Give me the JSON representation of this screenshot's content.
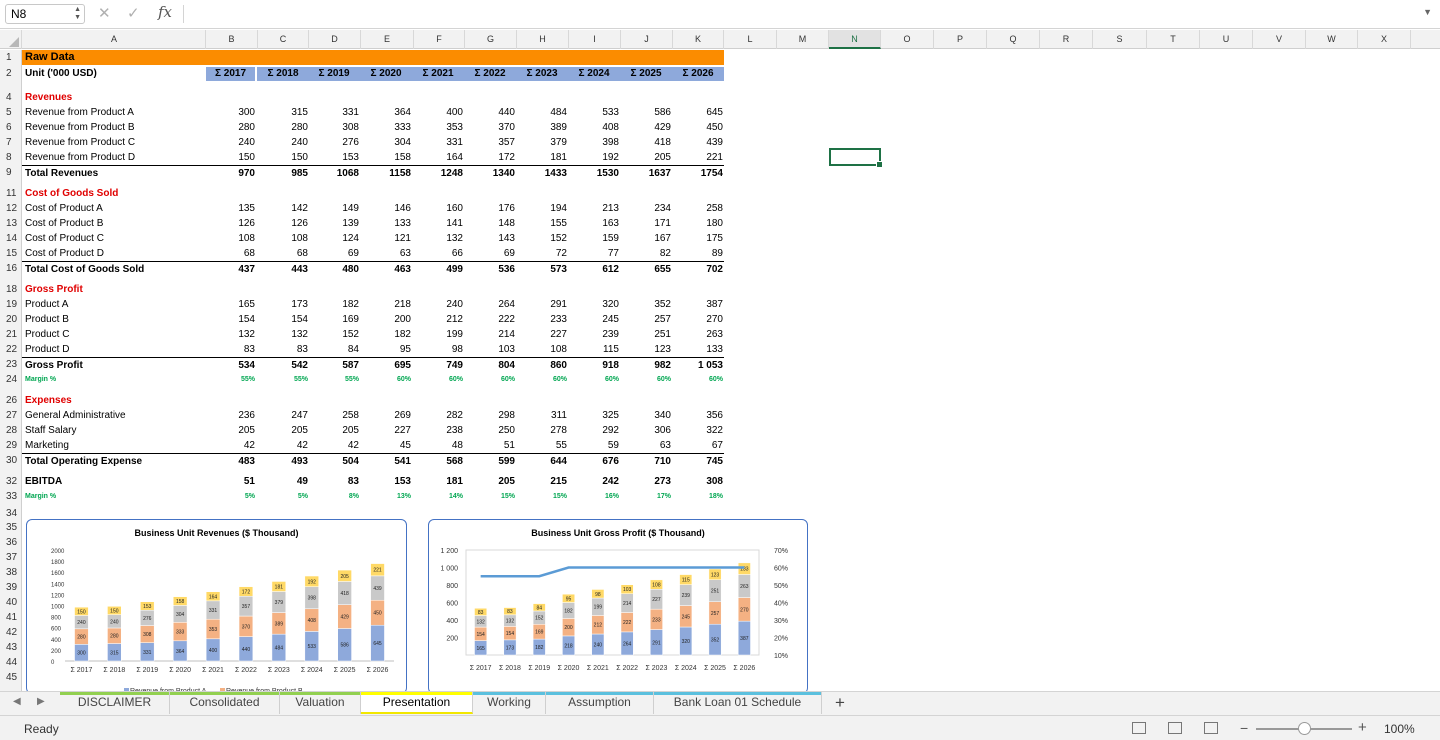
{
  "formula_bar": {
    "name_box": "N8",
    "fx": "fx",
    "formula": ""
  },
  "columns": [
    "A",
    "B",
    "C",
    "D",
    "E",
    "F",
    "G",
    "H",
    "I",
    "J",
    "K",
    "L",
    "M",
    "N",
    "O",
    "P",
    "Q",
    "R",
    "S",
    "T",
    "U",
    "V",
    "W",
    "X"
  ],
  "selected_cell": "N8",
  "sheet": {
    "title": "Raw Data",
    "unit_label": "Unit ('000 USD)",
    "years": [
      "Σ 2017",
      "Σ 2018",
      "Σ 2019",
      "Σ 2020",
      "Σ 2021",
      "Σ 2022",
      "Σ 2023",
      "Σ 2024",
      "Σ 2025",
      "Σ 2026"
    ],
    "rows": [
      {
        "n": "4",
        "label": "Revenues",
        "type": "sec"
      },
      {
        "n": "5",
        "label": "Revenue from Product A",
        "values": [
          "300",
          "315",
          "331",
          "364",
          "400",
          "440",
          "484",
          "533",
          "586",
          "645"
        ]
      },
      {
        "n": "6",
        "label": "Revenue from Product B",
        "values": [
          "280",
          "280",
          "308",
          "333",
          "353",
          "370",
          "389",
          "408",
          "429",
          "450"
        ]
      },
      {
        "n": "7",
        "label": "Revenue from Product C",
        "values": [
          "240",
          "240",
          "276",
          "304",
          "331",
          "357",
          "379",
          "398",
          "418",
          "439"
        ]
      },
      {
        "n": "8",
        "label": "Revenue from Product D",
        "values": [
          "150",
          "150",
          "153",
          "158",
          "164",
          "172",
          "181",
          "192",
          "205",
          "221"
        ]
      },
      {
        "n": "9",
        "label": "Total Revenues",
        "type": "tot",
        "values": [
          "970",
          "985",
          "1068",
          "1158",
          "1248",
          "1340",
          "1433",
          "1530",
          "1637",
          "1754"
        ]
      },
      {
        "n": "11",
        "label": "Cost of Goods Sold",
        "type": "sec"
      },
      {
        "n": "12",
        "label": "Cost of Product A",
        "values": [
          "135",
          "142",
          "149",
          "146",
          "160",
          "176",
          "194",
          "213",
          "234",
          "258"
        ]
      },
      {
        "n": "13",
        "label": "Cost of Product B",
        "values": [
          "126",
          "126",
          "139",
          "133",
          "141",
          "148",
          "155",
          "163",
          "171",
          "180"
        ]
      },
      {
        "n": "14",
        "label": "Cost of Product C",
        "values": [
          "108",
          "108",
          "124",
          "121",
          "132",
          "143",
          "152",
          "159",
          "167",
          "175"
        ]
      },
      {
        "n": "15",
        "label": "Cost of Product D",
        "values": [
          "68",
          "68",
          "69",
          "63",
          "66",
          "69",
          "72",
          "77",
          "82",
          "89"
        ]
      },
      {
        "n": "16",
        "label": "Total Cost of Goods Sold",
        "type": "tot",
        "values": [
          "437",
          "443",
          "480",
          "463",
          "499",
          "536",
          "573",
          "612",
          "655",
          "702"
        ]
      },
      {
        "n": "18",
        "label": "Gross Profit",
        "type": "sec"
      },
      {
        "n": "19",
        "label": "Product A",
        "values": [
          "165",
          "173",
          "182",
          "218",
          "240",
          "264",
          "291",
          "320",
          "352",
          "387"
        ]
      },
      {
        "n": "20",
        "label": "Product B",
        "values": [
          "154",
          "154",
          "169",
          "200",
          "212",
          "222",
          "233",
          "245",
          "257",
          "270"
        ]
      },
      {
        "n": "21",
        "label": "Product C",
        "values": [
          "132",
          "132",
          "152",
          "182",
          "199",
          "214",
          "227",
          "239",
          "251",
          "263"
        ]
      },
      {
        "n": "22",
        "label": "Product D",
        "values": [
          "83",
          "83",
          "84",
          "95",
          "98",
          "103",
          "108",
          "115",
          "123",
          "133"
        ]
      },
      {
        "n": "23",
        "label": "Gross Profit",
        "type": "tot",
        "values": [
          "534",
          "542",
          "587",
          "695",
          "749",
          "804",
          "860",
          "918",
          "982",
          "1 053"
        ]
      },
      {
        "n": "24",
        "label": "Margin %",
        "type": "mg",
        "values": [
          "55%",
          "55%",
          "55%",
          "60%",
          "60%",
          "60%",
          "60%",
          "60%",
          "60%",
          "60%"
        ]
      },
      {
        "n": "26",
        "label": "Expenses",
        "type": "sec"
      },
      {
        "n": "27",
        "label": "General Administrative",
        "values": [
          "236",
          "247",
          "258",
          "269",
          "282",
          "298",
          "311",
          "325",
          "340",
          "356"
        ]
      },
      {
        "n": "28",
        "label": "Staff Salary",
        "values": [
          "205",
          "205",
          "205",
          "227",
          "238",
          "250",
          "278",
          "292",
          "306",
          "322"
        ]
      },
      {
        "n": "29",
        "label": "Marketing",
        "values": [
          "42",
          "42",
          "42",
          "45",
          "48",
          "51",
          "55",
          "59",
          "63",
          "67"
        ]
      },
      {
        "n": "30",
        "label": "Total Operating Expense",
        "type": "tot",
        "values": [
          "483",
          "493",
          "504",
          "541",
          "568",
          "599",
          "644",
          "676",
          "710",
          "745"
        ]
      },
      {
        "n": "32",
        "label": "EBITDA",
        "type": "tot",
        "values": [
          "51",
          "49",
          "83",
          "153",
          "181",
          "205",
          "215",
          "242",
          "273",
          "308"
        ]
      },
      {
        "n": "33",
        "label": "Margin %",
        "type": "mg",
        "values": [
          "5%",
          "5%",
          "8%",
          "13%",
          "14%",
          "15%",
          "15%",
          "16%",
          "17%",
          "18%"
        ]
      }
    ],
    "extra_rows": [
      "34",
      "35",
      "36",
      "37",
      "38",
      "39",
      "40",
      "41",
      "42",
      "43",
      "44",
      "45"
    ]
  },
  "chart_data": [
    {
      "type": "bar",
      "stacked": true,
      "title": "Business Unit Revenues ($ Thousand)",
      "categories": [
        "Σ 2017",
        "Σ 2018",
        "Σ 2019",
        "Σ 2020",
        "Σ 2021",
        "Σ 2022",
        "Σ 2023",
        "Σ 2024",
        "Σ 2025",
        "Σ 2026"
      ],
      "ylim": [
        0,
        2000
      ],
      "yticks": [
        "0",
        "200",
        "400",
        "600",
        "800",
        "1000",
        "1200",
        "1400",
        "1600",
        "1800",
        "2000"
      ],
      "series": [
        {
          "name": "Revenue from Product A",
          "color": "#8ea9db",
          "values": [
            300,
            315,
            331,
            364,
            400,
            440,
            484,
            533,
            586,
            645
          ]
        },
        {
          "name": "Revenue from Product B",
          "color": "#f4b183",
          "values": [
            280,
            280,
            308,
            333,
            353,
            370,
            389,
            408,
            429,
            450
          ]
        },
        {
          "name": "",
          "color": "#c9c9c9",
          "values": [
            240,
            240,
            276,
            304,
            331,
            357,
            379,
            398,
            418,
            439
          ]
        },
        {
          "name": "",
          "color": "#ffd966",
          "values": [
            150,
            150,
            153,
            158,
            164,
            172,
            181,
            192,
            205,
            221
          ]
        }
      ],
      "legend": "bottom"
    },
    {
      "type": "bar",
      "stacked": true,
      "title": "Business Unit Gross Profit ($ Thousand)",
      "categories": [
        "Σ 2017",
        "Σ 2018",
        "Σ 2019",
        "Σ 2020",
        "Σ 2021",
        "Σ 2022",
        "Σ 2023",
        "Σ 2024",
        "Σ 2025",
        "Σ 2026"
      ],
      "ylim": [
        0,
        1200
      ],
      "yticks": [
        "",
        "200",
        "400",
        "600",
        "800",
        "1 000",
        "1 200"
      ],
      "y2lim": [
        0.1,
        0.7
      ],
      "y2ticks": [
        "10%",
        "20%",
        "30%",
        "40%",
        "50%",
        "60%",
        "70%"
      ],
      "series": [
        {
          "name": "",
          "color": "#8ea9db",
          "values": [
            165,
            173,
            182,
            218,
            240,
            264,
            291,
            320,
            352,
            387
          ]
        },
        {
          "name": "",
          "color": "#f4b183",
          "values": [
            154,
            154,
            169,
            200,
            212,
            222,
            233,
            245,
            257,
            270
          ]
        },
        {
          "name": "",
          "color": "#c9c9c9",
          "values": [
            132,
            132,
            152,
            182,
            199,
            214,
            227,
            239,
            251,
            263
          ]
        },
        {
          "name": "",
          "color": "#ffd966",
          "values": [
            83,
            83,
            84,
            95,
            98,
            103,
            108,
            115,
            123,
            133
          ]
        }
      ],
      "line": {
        "name": "",
        "color": "#5b9bd5",
        "values": [
          0.55,
          0.55,
          0.55,
          0.6,
          0.6,
          0.6,
          0.6,
          0.6,
          0.6,
          0.6
        ]
      }
    }
  ],
  "tabs": [
    {
      "label": "DISCLAIMER",
      "stripe": "#92d050"
    },
    {
      "label": "Consolidated",
      "stripe": "#92d050"
    },
    {
      "label": "Valuation",
      "stripe": "#92d050"
    },
    {
      "label": "Presentation",
      "stripe": "#ffff00",
      "active": true
    },
    {
      "label": "Working",
      "stripe": "#5bc0de"
    },
    {
      "label": "Assumption",
      "stripe": "#5bc0de"
    },
    {
      "label": "Bank Loan 01 Schedule",
      "stripe": "#5bc0de"
    }
  ],
  "status": {
    "ready": "Ready",
    "zoom": "100%"
  }
}
